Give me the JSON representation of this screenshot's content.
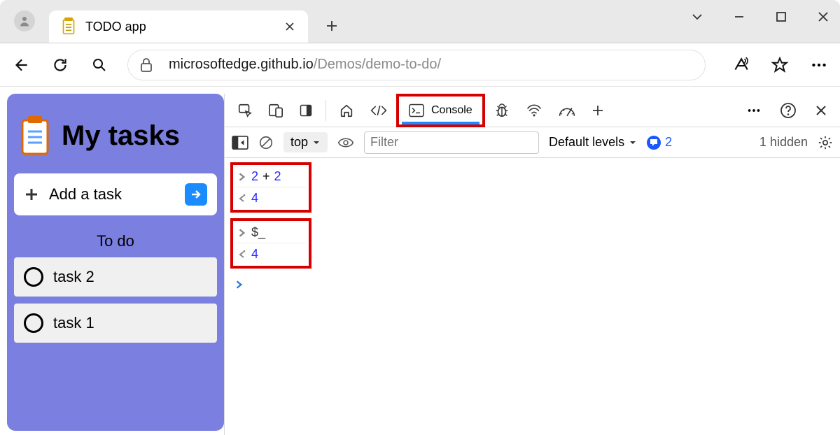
{
  "browser": {
    "tab_title": "TODO app",
    "url_host": "microsoftedge.github.io",
    "url_path": "/Demos/demo-to-do/"
  },
  "page": {
    "title": "My tasks",
    "add_task_label": "Add a task",
    "section_label": "To do",
    "tasks": [
      "task 2",
      "task 1"
    ]
  },
  "devtools": {
    "console_tab_label": "Console",
    "context_label": "top",
    "filter_placeholder": "Filter",
    "levels_label": "Default levels",
    "issues_count": "2",
    "hidden_label": "1 hidden",
    "log": [
      {
        "input": [
          {
            "t": "num",
            "v": "2"
          },
          {
            "t": "op",
            "v": "+"
          },
          {
            "t": "num",
            "v": "2"
          }
        ],
        "output": "4"
      },
      {
        "input": [
          {
            "t": "var",
            "v": "$_"
          }
        ],
        "output": "4"
      }
    ]
  }
}
